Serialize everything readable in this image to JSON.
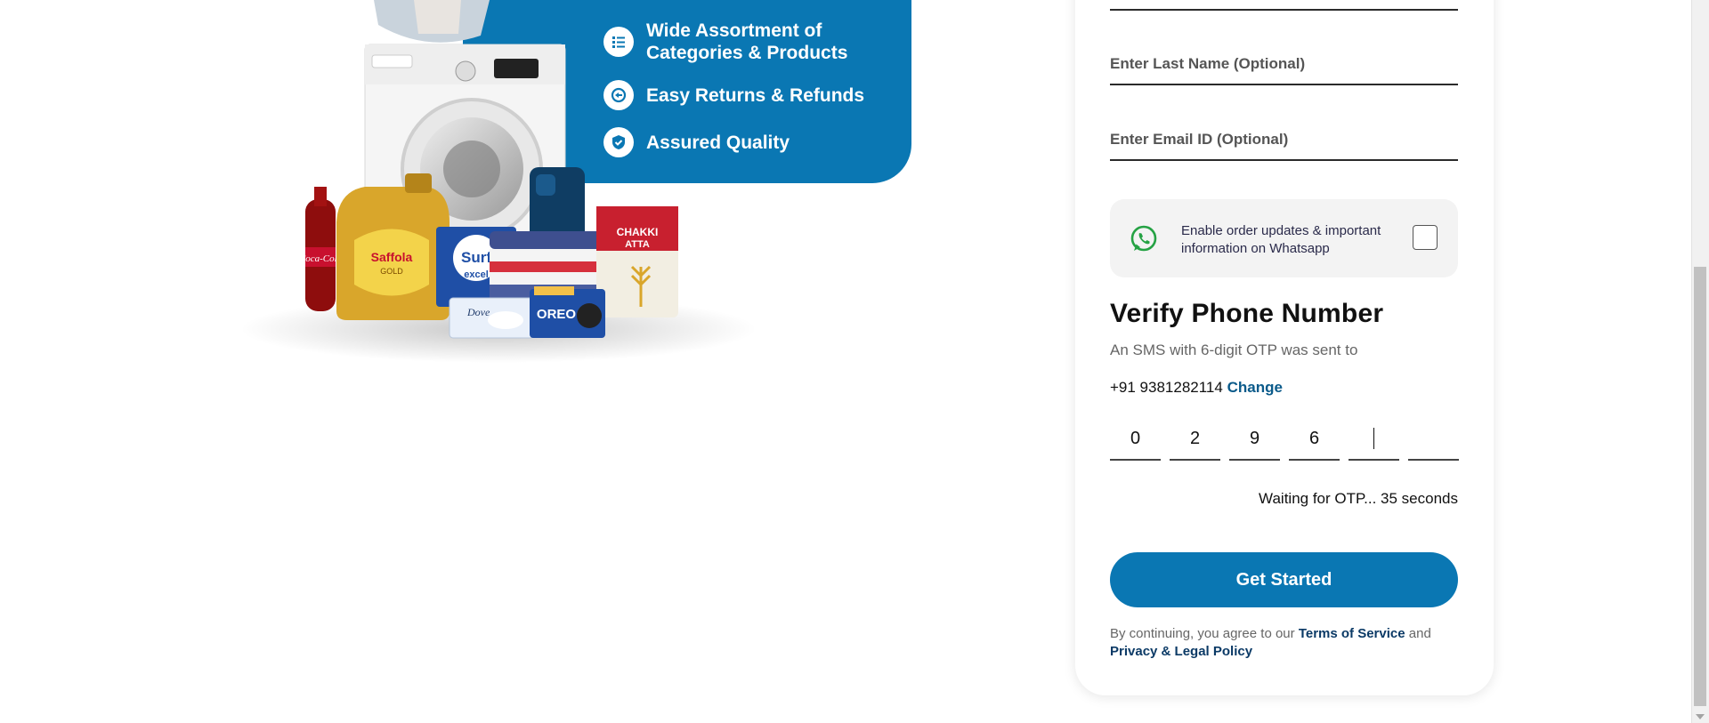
{
  "promo": {
    "features": [
      {
        "icon": "list-icon",
        "text": "Wide Assortment of Categories & Products"
      },
      {
        "icon": "returns-icon",
        "text": "Easy Returns & Refunds"
      },
      {
        "icon": "shield-check-icon",
        "text": "Assured Quality"
      }
    ],
    "products": [
      "Coca-Cola",
      "Saffola GOLD",
      "Surf excel",
      "Dove",
      "OREO",
      "CHAKKI ATTA"
    ]
  },
  "form": {
    "last_name_placeholder": "Enter Last Name (Optional)",
    "email_placeholder": "Enter Email ID (Optional)",
    "whatsapp_text": "Enable order updates & important information on Whatsapp",
    "whatsapp_checked": false,
    "verify_title": "Verify Phone Number",
    "verify_subtitle": "An SMS with 6-digit OTP was sent to",
    "phone_number": "+91 9381282114",
    "change_label": "Change",
    "otp_digits": [
      "0",
      "2",
      "9",
      "6",
      "",
      ""
    ],
    "waiting_text": "Waiting for OTP... 35 seconds",
    "cta_label": "Get Started",
    "legal_prefix": "By continuing, you agree to our",
    "terms_label": "Terms of Service",
    "legal_and": "and",
    "privacy_label": "Privacy & Legal Policy"
  },
  "colors": {
    "brand_blue": "#0a77b3",
    "link_blue": "#0b3a66",
    "whatsapp_green": "#25a244"
  }
}
